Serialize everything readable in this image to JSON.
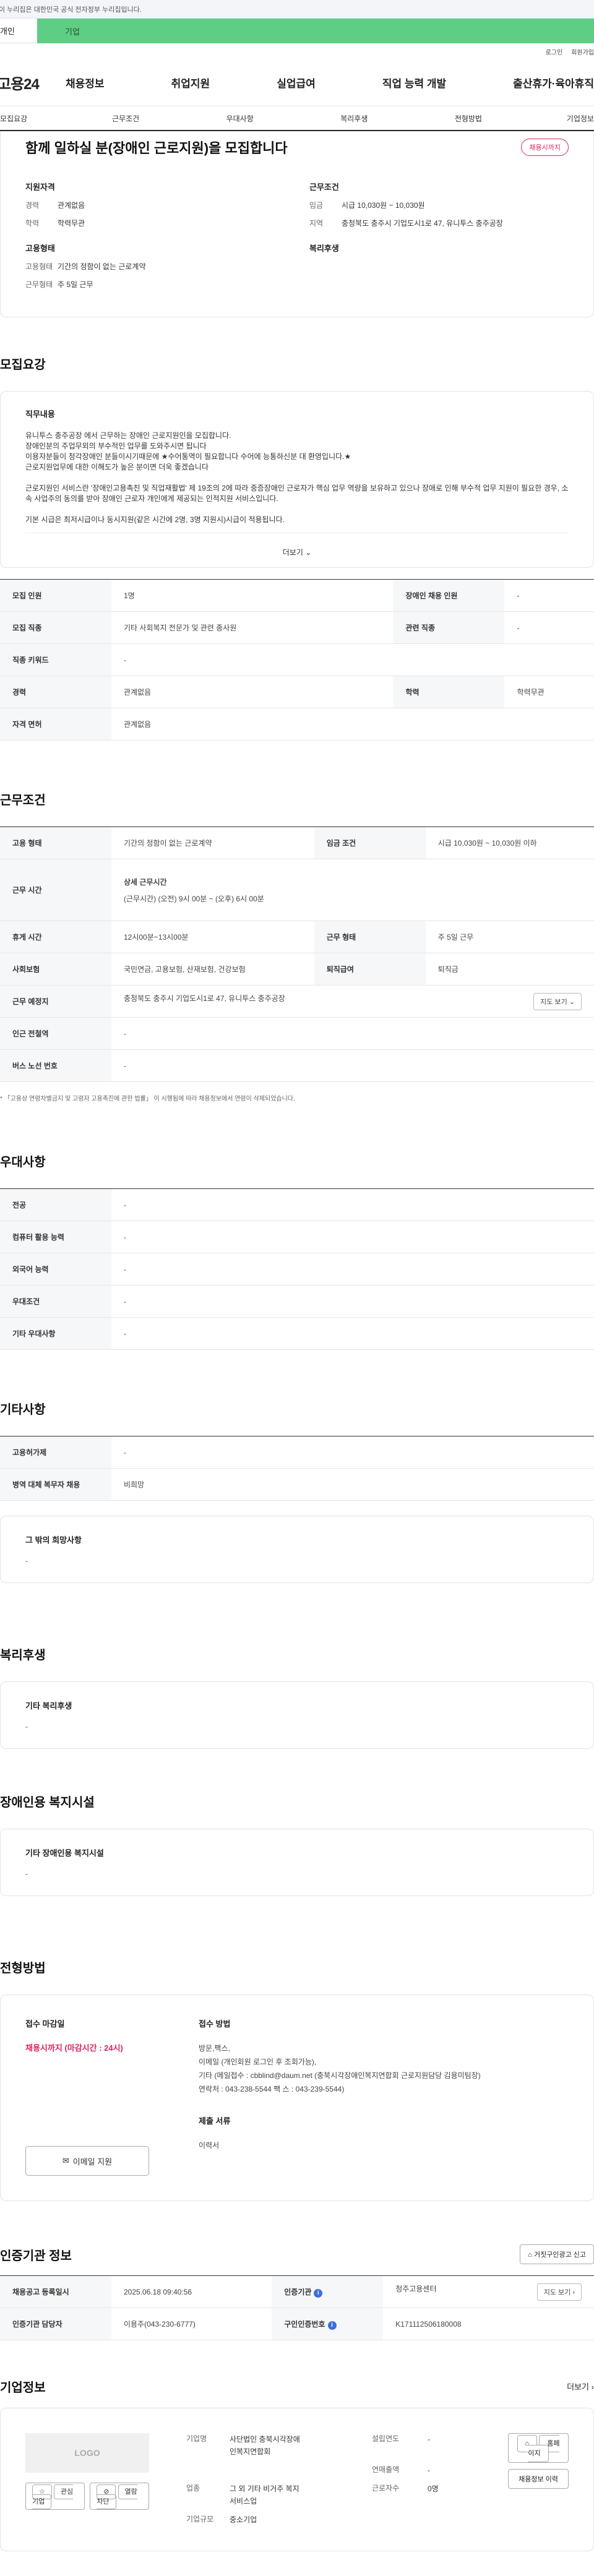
{
  "gov_bar": "이 누리집은 대한민국 공식 전자정부 누리집입니다.",
  "top_tabs": [
    "개인",
    "기업"
  ],
  "util": [
    "로그인",
    "회원가입"
  ],
  "gnb": {
    "logo": "고용24",
    "menu": [
      "채용정보",
      "취업지원",
      "실업급여",
      "직업 능력 개발",
      "출산휴가·육아휴직"
    ]
  },
  "subnav": [
    "모집요강",
    "근무조건",
    "우대사항",
    "복리후생",
    "전형방법",
    "기업정보"
  ],
  "job": {
    "title": "함께 일하실 분(장애인 근로지원)을 모집합니다",
    "deadline_badge": "채용시까지"
  },
  "summary": {
    "qualification_title": "지원자격",
    "career_label": "경력",
    "career": "관계없음",
    "education_label": "학력",
    "education": "학력무관",
    "employment_title": "고용형태",
    "emp_type_label": "고용형태",
    "emp_type": "기간의 정함이 없는 근로계약",
    "work_form_label": "근무형태",
    "work_form": "주 5일 근무",
    "condition_title": "근무조건",
    "wage_label": "임금",
    "wage": "시급 10,030원 ~ 10,030원",
    "region_label": "지역",
    "region": "충청북도 충주시 기업도시1로 47, 유니투스 충주공장",
    "welfare_title": "복리후생"
  },
  "recruit": {
    "section_title": "모집요강",
    "desc_title": "직무내용",
    "desc": "유니투스 충주공장 에서 근무하는 장애인 근로지원인을 모집합니다.\n장애인분의 주업무외의 부수적인 업무를 도와주시면 됩니다\n이용자분들이 청각장애인 분들이시기때문에  ★수어통역이 필요합니다 수어에 능통하신분 대 환영입니다.★\n근로지원업무에 대한 이해도가 높은 분이면 더욱 좋겠습니다\n\n근로지원인 서비스란 '장애인고용촉진 및 직업재활법' 제 19조의 2에 따라 중증장애인 근로자가 핵심 업무 역량을 보유하고 있으나 장애로 인해 부수적 업무 지원이 필요한 경우, 소속 사업주의 동의를 받아 장애인 근로자 개인에게 제공되는 인적지원 서비스입니다.\n\n기본 시급은 최저시급이나 동시지원(같은 시간에 2명, 3명 지원시)시급이 적용됩니다.",
    "more": "더보기",
    "rows": [
      [
        "모집 인원",
        "1명",
        "장애인 채용 인원",
        "-"
      ],
      [
        "모집 직종",
        "기타 사회복지 전문가 및 관련 종사원",
        "관련 직종",
        "-"
      ],
      [
        "직종 키워드",
        "-"
      ],
      [
        "경력",
        "관계없음",
        "학력",
        "학력무관"
      ],
      [
        "자격 면허",
        "관계없음"
      ]
    ]
  },
  "condition": {
    "section_title": "근무조건",
    "emp_type_label": "고용 형태",
    "emp_type": "기간의 정함이 없는 근로계약",
    "wage_label": "임금 조건",
    "wage": "시급 10,030원 ~ 10,030원 이하",
    "hours_label": "근무 시간",
    "hours_title": "상세 근무시간",
    "hours": "(근무시간) (오전) 9시 00분 ~ (오후) 6시 00분",
    "break_label": "휴게 시간",
    "break": "12시00분~13시00분",
    "form_label": "근무 형태",
    "form": "주 5일 근무",
    "insurance_label": "사회보험",
    "insurance": "국민연금, 고용보험, 산재보험, 건강보험",
    "severance_label": "퇴직급여",
    "severance": "퇴직금",
    "place_label": "근무 예정지",
    "place": "충청북도 충주시 기업도시1로 47, 유니투스 충주공장",
    "map_btn": "지도 보기",
    "subway_label": "인근 전철역",
    "subway": "-",
    "bus_label": "버스 노선 번호",
    "bus": "-",
    "note": "* 「고용상 연령차별금지 및 고령자 고용촉진에 관한 법률」 이 시행됨에 따라 채용정보에서 연령이 삭제되었습니다."
  },
  "preference": {
    "section_title": "우대사항",
    "rows": [
      [
        "전공",
        "-"
      ],
      [
        "컴퓨터 활용 능력",
        "-"
      ],
      [
        "외국어 능력",
        "-"
      ],
      [
        "우대조건",
        "-"
      ],
      [
        "기타 우대사항",
        "-"
      ]
    ]
  },
  "etc": {
    "section_title": "기타사항",
    "rows": [
      [
        "고용허가제",
        "-"
      ],
      [
        "병역 대체 복무자 채용",
        "비희망"
      ]
    ],
    "box_title": "그 밖의 희망사항",
    "box_value": "-"
  },
  "welfare": {
    "section_title": "복리후생",
    "box_title": "기타 복리후생",
    "box_value": "-"
  },
  "facility": {
    "section_title": "장애인용 복지시설",
    "box_title": "기타 장애인용 복지시설",
    "box_value": "-"
  },
  "process": {
    "section_title": "전형방법",
    "deadline_title": "접수 마감일",
    "deadline": "채용시까지 (마감시간 : 24시)",
    "method_title": "접수 방법",
    "method": "방문,팩스,\n이메일 (개인회원 로그인 후 조회가능),\n기타 (메일접수 : cbblind@daum.net (충북시각장애인복지연합회 근로지원담당 김용미팀장)\n연락처 : 043-238-5544 팩 스 : 043-239-5544)",
    "docs_title": "제출 서류",
    "docs": "이력서",
    "email_btn": "이메일 지원"
  },
  "institution": {
    "section_title": "인증기관 정보",
    "report_btn": "거짓구인광고 신고",
    "reg_label": "채용공고 등록일시",
    "reg": "2025.06.18 09:40:56",
    "agency_label": "인증기관",
    "agency": "청주고용센터",
    "map_btn": "지도 보기",
    "manager_label": "인증기관 담당자",
    "manager": "이용주(043-230-6777)",
    "certno_label": "구인인증번호",
    "certno": "K171112506180008"
  },
  "company": {
    "section_title": "기업정보",
    "more": "더보기",
    "logo": "LOGO",
    "btn_interest": "관심기업",
    "btn_block": "열람차단",
    "name_label": "기업명",
    "name": "사단법인 충북시각장애인복지연합회",
    "industry_label": "업종",
    "industry": "그 외 기타 비거주 복지 서비스업",
    "size_label": "기업규모",
    "size": "중소기업",
    "founded_label": "설립연도",
    "founded": "-",
    "sales_label": "연매출액",
    "sales": "-",
    "employees_label": "근로자수",
    "employees": "0명",
    "btn_home": "홈페이지",
    "btn_jobs": "채용정보 이력"
  }
}
